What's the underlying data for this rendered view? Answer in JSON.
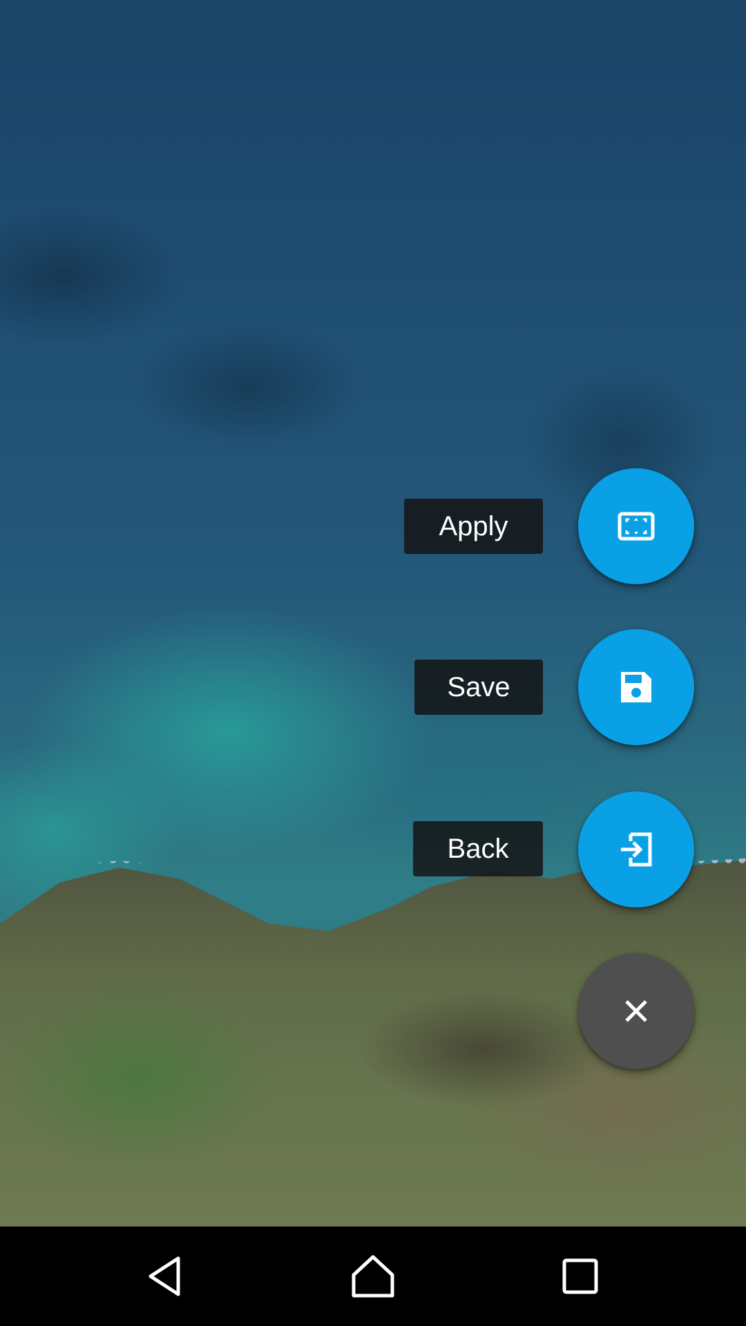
{
  "wallpaper": {
    "description_icon": "aerial-coastline-wallpaper"
  },
  "speed_dial": {
    "accent_color": "#0aa0e6",
    "close_color": "#4f4f4f",
    "actions": [
      {
        "label": "Apply",
        "icon": "fullscreen-frame-icon"
      },
      {
        "label": "Save",
        "icon": "floppy-disk-icon"
      },
      {
        "label": "Back",
        "icon": "exit-to-app-icon"
      }
    ],
    "close_icon": "close-icon"
  },
  "navbar": {
    "back_icon": "back-triangle-icon",
    "home_icon": "home-icon",
    "recents_icon": "recents-square-icon"
  }
}
